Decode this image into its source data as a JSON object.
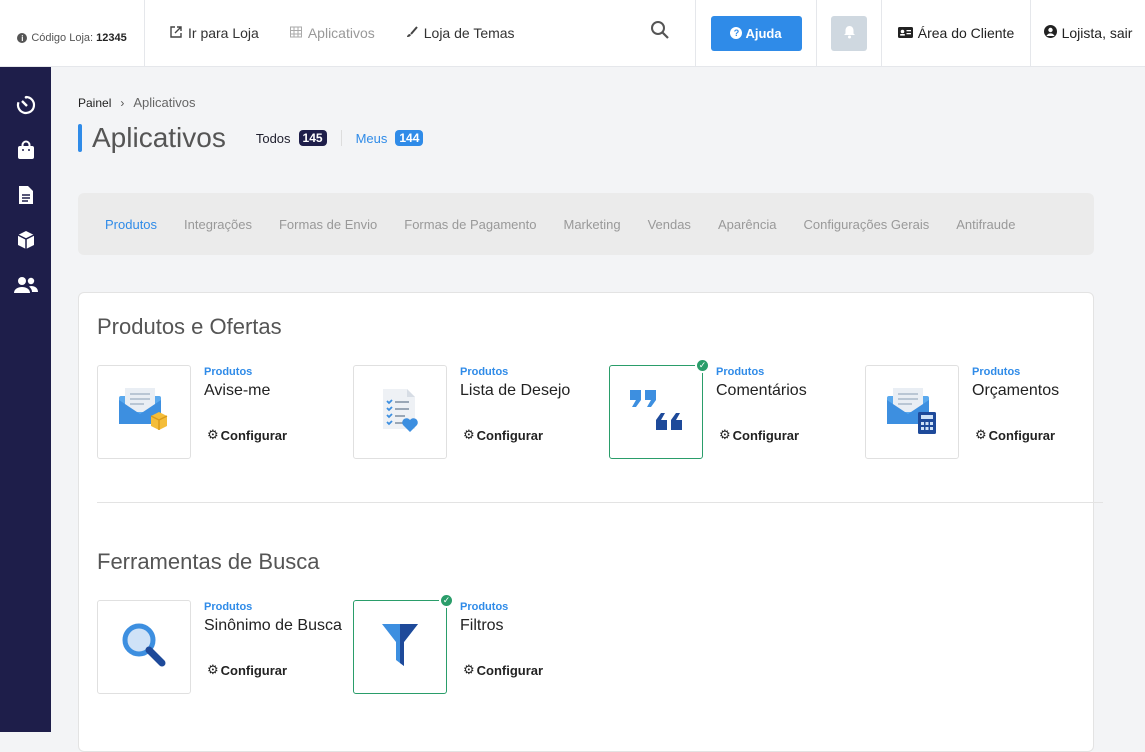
{
  "header": {
    "store_code_label": "Código Loja:",
    "store_code": "12345",
    "nav": [
      {
        "label": "Ir para Loja",
        "icon": "external-link-icon"
      },
      {
        "label": "Aplicativos",
        "icon": "grid-icon"
      },
      {
        "label": "Loja de Temas",
        "icon": "brush-icon"
      }
    ],
    "help_label": "Ajuda",
    "client_area_label": "Área do Cliente",
    "user_label": "Lojista, sair"
  },
  "sidebar": {
    "items": [
      "dashboard-icon",
      "shopping-bag-icon",
      "document-icon",
      "box-icon",
      "users-icon"
    ]
  },
  "breadcrumb": {
    "home": "Painel",
    "current": "Aplicativos"
  },
  "page": {
    "title": "Aplicativos",
    "filter_all_label": "Todos",
    "filter_all_count": "145",
    "filter_mine_label": "Meus",
    "filter_mine_count": "144"
  },
  "categories": [
    "Produtos",
    "Integrações",
    "Formas de Envio",
    "Formas de Pagamento",
    "Marketing",
    "Vendas",
    "Aparência",
    "Configurações Gerais",
    "Antifraude"
  ],
  "active_category": "Produtos",
  "sections": [
    {
      "title": "Produtos e Ofertas",
      "apps": [
        {
          "category": "Produtos",
          "name": "Avise-me",
          "action": "Configurar",
          "installed": false,
          "icon": "envelope-box-icon"
        },
        {
          "category": "Produtos",
          "name": "Lista de Desejo",
          "action": "Configurar",
          "installed": false,
          "icon": "checklist-heart-icon"
        },
        {
          "category": "Produtos",
          "name": "Comentários",
          "action": "Configurar",
          "installed": true,
          "icon": "quotes-icon"
        },
        {
          "category": "Produtos",
          "name": "Orçamentos",
          "action": "Configurar",
          "installed": false,
          "icon": "envelope-calculator-icon"
        }
      ]
    },
    {
      "title": "Ferramentas de Busca",
      "apps": [
        {
          "category": "Produtos",
          "name": "Sinônimo de Busca",
          "action": "Configurar",
          "installed": false,
          "icon": "magnifier-icon"
        },
        {
          "category": "Produtos",
          "name": "Filtros",
          "action": "Configurar",
          "installed": true,
          "icon": "funnel-icon"
        }
      ]
    }
  ],
  "colors": {
    "accent": "#2f8be8",
    "sidebar": "#1e1e4a",
    "installed": "#2a9d6a"
  }
}
